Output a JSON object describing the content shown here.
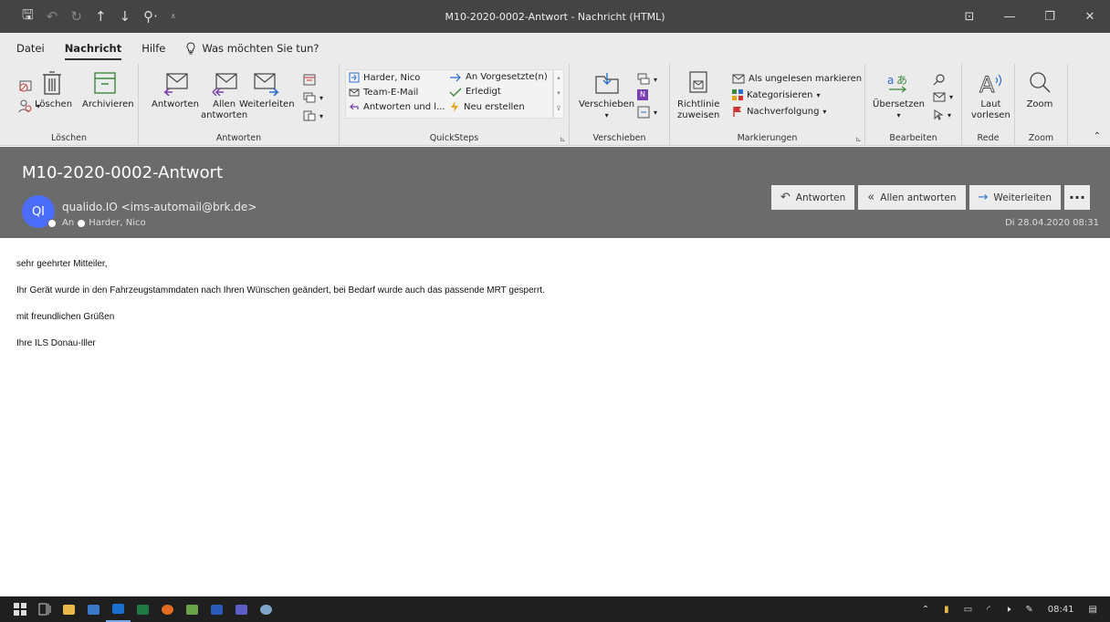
{
  "window": {
    "title": "M10-2020-0002-Antwort  -  Nachricht (HTML)",
    "quick_access": [
      "save-icon",
      "undo-icon",
      "redo-icon",
      "up-arrow-icon",
      "down-arrow-icon",
      "attach-icon",
      "customize-icon"
    ],
    "controls": {
      "ribbon_options": "⊡",
      "minimize": "—",
      "restore": "❐",
      "close": "✕"
    }
  },
  "menu": {
    "items": [
      "Datei",
      "Nachricht",
      "Hilfe"
    ],
    "active": "Nachricht",
    "tell_me": "Was möchten Sie tun?"
  },
  "ribbon": {
    "loeschen": {
      "label": "Löschen",
      "delete": "Löschen",
      "archive": "Archivieren"
    },
    "antworten": {
      "label": "Antworten",
      "reply": "Antworten",
      "reply_all_1": "Allen",
      "reply_all_2": "antworten",
      "forward": "Weiterleiten"
    },
    "quicksteps": {
      "label": "QuickSteps",
      "items": [
        "Harder, Nico",
        "Team-E-Mail",
        "Antworten und l...",
        "An Vorgesetzte(n)",
        "Erledigt",
        "Neu erstellen"
      ]
    },
    "verschieben": {
      "label": "Verschieben",
      "move": "Verschieben"
    },
    "markierungen": {
      "label": "Markierungen",
      "policy_1": "Richtlinie",
      "policy_2": "zuweisen",
      "unread": "Als ungelesen markieren",
      "categorize": "Kategorisieren",
      "followup": "Nachverfolgung"
    },
    "bearbeiten": {
      "label": "Bearbeiten",
      "translate": "Übersetzen"
    },
    "rede": {
      "label": "Rede",
      "read_1": "Laut",
      "read_2": "vorlesen"
    },
    "zoom": {
      "label": "Zoom",
      "zoom": "Zoom"
    }
  },
  "message": {
    "subject": "M10-2020-0002-Antwort",
    "avatar_initials": "QI",
    "sender": "qualido.IO <ims-automail@brk.de>",
    "to_label": "An",
    "to_name": "Harder, Nico",
    "date": "Di 28.04.2020 08:31",
    "actions": {
      "reply": "Antworten",
      "reply_all": "Allen antworten",
      "forward": "Weiterleiten",
      "more": "···"
    },
    "body": [
      "sehr geehrter Mitteiler,",
      "Ihr Gerät wurde in den Fahrzeugstammdaten nach Ihren Wünschen geändert, bei Bedarf wurde auch das passende MRT gesperrt.",
      "mit freundlichen Grüßen",
      "Ihre ILS Donau-Iller"
    ]
  },
  "taskbar": {
    "time": "08:41",
    "accent": "#4a6dfe"
  }
}
